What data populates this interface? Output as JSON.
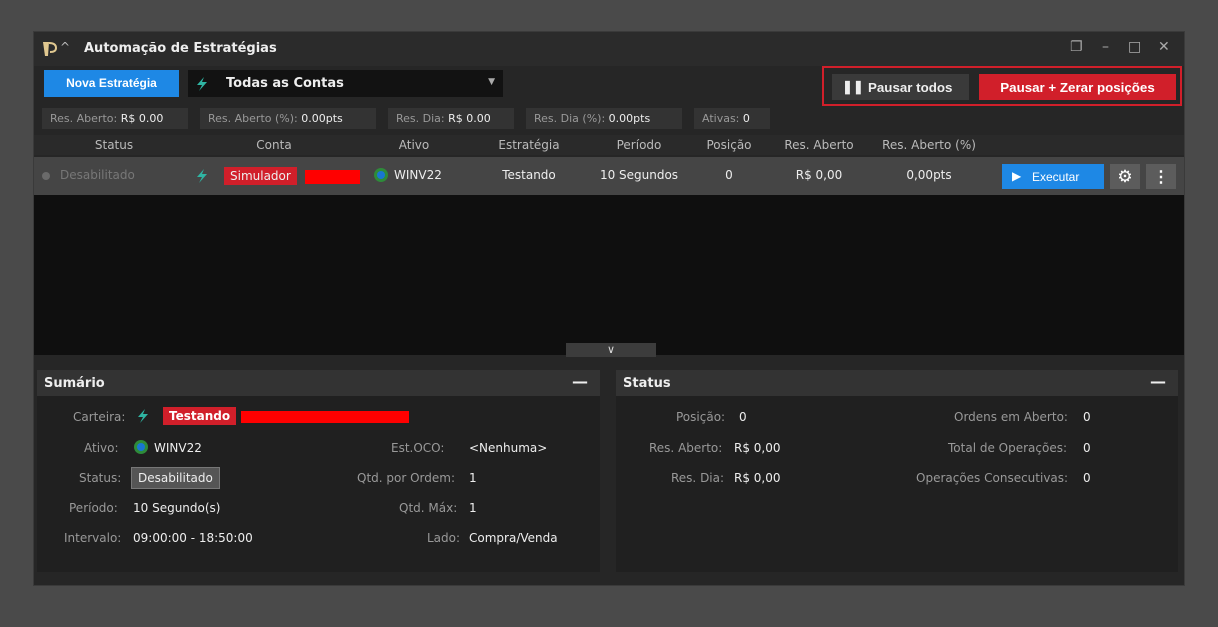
{
  "window": {
    "title": "Automação de Estratégias",
    "controls": [
      "❐",
      "–",
      "□",
      "✕"
    ]
  },
  "toolbar": {
    "new_strategy": "Nova Estratégia",
    "account_select": "Todas as Contas",
    "pause_all": "Pausar todos",
    "pause_zero": "Pausar + Zerar posições"
  },
  "stats": [
    {
      "label": "Res. Aberto:",
      "value": "R$ 0.00"
    },
    {
      "label": "Res. Aberto (%):",
      "value": "0.00pts"
    },
    {
      "label": "Res. Dia:",
      "value": "R$ 0.00"
    },
    {
      "label": "Res. Dia (%):",
      "value": "0.00pts"
    },
    {
      "label": "Ativas:",
      "value": "0"
    }
  ],
  "columns": [
    "Status",
    "Conta",
    "Ativo",
    "Estratégia",
    "Período",
    "Posição",
    "Res. Aberto",
    "Res. Aberto (%)"
  ],
  "row": {
    "status": "Desabilitado",
    "conta": "Simulador",
    "ativo": "WINV22",
    "estrategia": "Testando",
    "periodo": "10 Segundos",
    "posicao": "0",
    "res_aberto": "R$ 0,00",
    "res_aberto_pct": "0,00pts",
    "execute": "Executar"
  },
  "summary": {
    "title": "Sumário",
    "carteira_label": "Carteira:",
    "carteira": "Testando",
    "ativo_label": "Ativo:",
    "ativo": "WINV22",
    "status_label": "Status:",
    "status": "Desabilitado",
    "periodo_label": "Período:",
    "periodo": "10 Segundo(s)",
    "intervalo_label": "Intervalo:",
    "intervalo": "09:00:00 - 18:50:00",
    "estoco_label": "Est.OCO:",
    "estoco": "<Nenhuma>",
    "qtd_ordem_label": "Qtd. por Ordem:",
    "qtd_ordem": "1",
    "qtd_max_label": "Qtd. Máx:",
    "qtd_max": "1",
    "lado_label": "Lado:",
    "lado": "Compra/Venda"
  },
  "status_panel": {
    "title": "Status",
    "posicao_label": "Posição:",
    "posicao": "0",
    "res_aberto_label": "Res. Aberto:",
    "res_aberto": "R$ 0,00",
    "res_dia_label": "Res. Dia:",
    "res_dia": "R$ 0,00",
    "ordens_label": "Ordens em Aberto:",
    "ordens": "0",
    "total_label": "Total de Operações:",
    "total": "0",
    "consec_label": "Operações Consecutivas:",
    "consec": "0"
  },
  "colors": {
    "accent": "#1e88e5",
    "danger": "#d11f2a",
    "bolt": "#2fb5a3"
  }
}
